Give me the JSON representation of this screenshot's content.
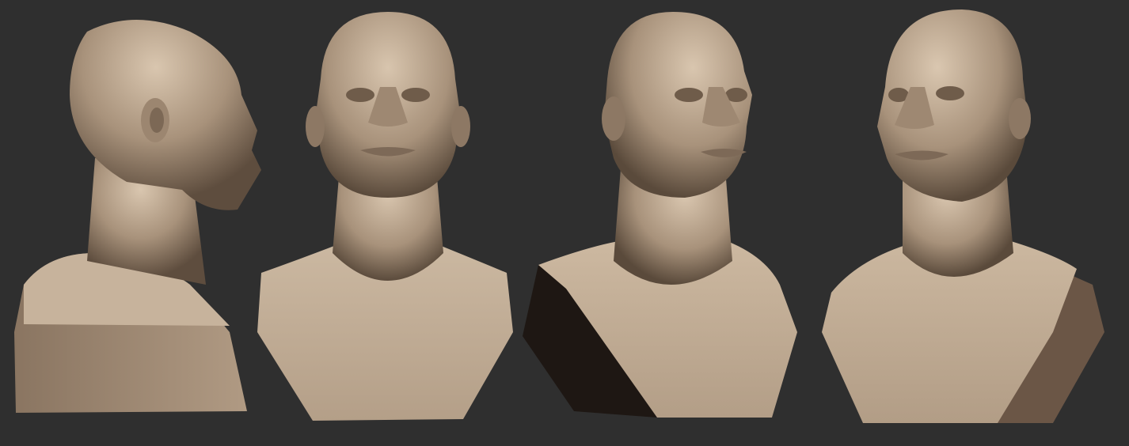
{
  "scene": {
    "background": "#2f2f2f",
    "material_color": "#b29e88",
    "views": [
      {
        "view": "profile-right"
      },
      {
        "view": "front"
      },
      {
        "view": "three-quarter-right"
      },
      {
        "view": "three-quarter-left"
      }
    ]
  }
}
